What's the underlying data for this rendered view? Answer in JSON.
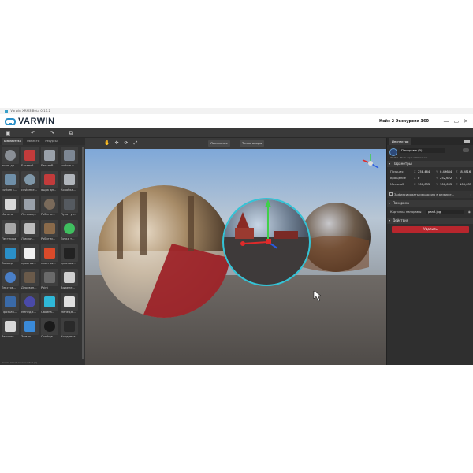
{
  "window": {
    "title": "Varwin XRMS Beta 0.11.2"
  },
  "brand": {
    "logo_text": "VARWIN",
    "project_title": "Кейс 2 Экскурсия 360"
  },
  "library": {
    "tabs": [
      "Библиотека",
      "Объекты",
      "Ресурсы"
    ],
    "items": [
      {
        "label": "ящик дл...",
        "icon": "box-icon",
        "color": "#8a8f96"
      },
      {
        "label": "Баскетб...",
        "icon": "backboard-icon",
        "color": "#c23b3b"
      },
      {
        "label": "Баскетб...",
        "icon": "basketball-hoop-icon",
        "color": "#9aa1aa"
      },
      {
        "label": "custom e...",
        "icon": "cube-icon",
        "color": "#7d8794"
      },
      {
        "label": "custom t...",
        "icon": "cube-icon",
        "color": "#6f8fa8"
      },
      {
        "label": "custom e...",
        "icon": "cube-icon",
        "color": "#7f97a8"
      },
      {
        "label": "ящик дл...",
        "icon": "red-box-icon",
        "color": "#c23b3b"
      },
      {
        "label": "Коробка...",
        "icon": "grey-box-icon",
        "color": "#b0b5bb"
      },
      {
        "label": "Монета",
        "icon": "coin-icon",
        "color": "#d8d8d8"
      },
      {
        "label": "Летающ...",
        "icon": "flying-cube-icon",
        "color": "#9aa1aa"
      },
      {
        "label": "Робот к...",
        "icon": "robot-icon",
        "color": "#7a6a5a"
      },
      {
        "label": "Пульт уп...",
        "icon": "remote-icon",
        "color": "#555a60"
      },
      {
        "label": "Лестница",
        "icon": "ladder-icon",
        "color": "#a8a8a8"
      },
      {
        "label": "Лампоч...",
        "icon": "lamp-icon",
        "color": "#bdbdbd"
      },
      {
        "label": "Робот м...",
        "icon": "robot-arm-icon",
        "color": "#8a6a4a"
      },
      {
        "label": "Точка т...",
        "icon": "teleport-point-icon",
        "color": "#3fbf5f"
      },
      {
        "label": "Таймер",
        "icon": "timer-icon",
        "color": "#2a8fc7"
      },
      {
        "label": "простая...",
        "icon": "bulb-icon",
        "color": "#f0f0f0"
      },
      {
        "label": "простая...",
        "icon": "button-icon",
        "color": "#d94a2a"
      },
      {
        "label": "простая...",
        "icon": "panel-icon",
        "color": "#222"
      },
      {
        "label": "Текстов...",
        "icon": "text-icon",
        "color": "#4a7fc7"
      },
      {
        "label": "Деревян...",
        "icon": "wood-icon",
        "color": "#6a5a4a"
      },
      {
        "label": "Point",
        "icon": "point-icon",
        "color": "#6a6a6a"
      },
      {
        "label": "Выделе...",
        "icon": "selection-icon",
        "color": "#cfcfcf"
      },
      {
        "label": "Прозрач...",
        "icon": "transparent-icon",
        "color": "#3a6aa8"
      },
      {
        "label": "Менедж...",
        "icon": "manager-icon",
        "color": "#4a4aa8"
      },
      {
        "label": "Обозна...",
        "icon": "outline-sphere-icon",
        "color": "#2fb8d8"
      },
      {
        "label": "Менедж...",
        "icon": "speaker-icon",
        "color": "#e0e0e0"
      },
      {
        "label": "Располо...",
        "icon": "pin-icon",
        "color": "#d8d8d8"
      },
      {
        "label": "Земля",
        "icon": "earth-icon",
        "color": "#3a8ad8"
      },
      {
        "label": "Сообще...",
        "icon": "message-icon",
        "color": "#1a1a1a"
      },
      {
        "label": "Кординат...",
        "icon": "tablet-icon",
        "color": "#2a2a2a"
      }
    ],
    "status": "Varwin Client is connected (0)"
  },
  "view": {
    "local_label": "Локальная",
    "pivot_label": "Точка опоры"
  },
  "inspector": {
    "tab": "Инспектор",
    "object_name": "Панорама (0)",
    "object_sub": "ID 259 · Не выбрано Название",
    "sections": {
      "params": "Параметры",
      "panorama": "Панорама",
      "actions": "Действия"
    },
    "position": {
      "label": "Позиция",
      "x": "258,464",
      "y": "0,49684",
      "z": "-8,2816"
    },
    "rotation": {
      "label": "Вращение",
      "x": "0",
      "y": "252,622",
      "z": "0"
    },
    "scale": {
      "label": "Масштаб",
      "x": "100,035",
      "y": "100,035",
      "z": "100,035"
    },
    "fix_label": "Зафиксировать иерархию в режиме...",
    "panorama_picture_label": "Картинка панорамы",
    "panorama_picture_value": "pan3.jpg",
    "delete_label": "Удалить"
  }
}
